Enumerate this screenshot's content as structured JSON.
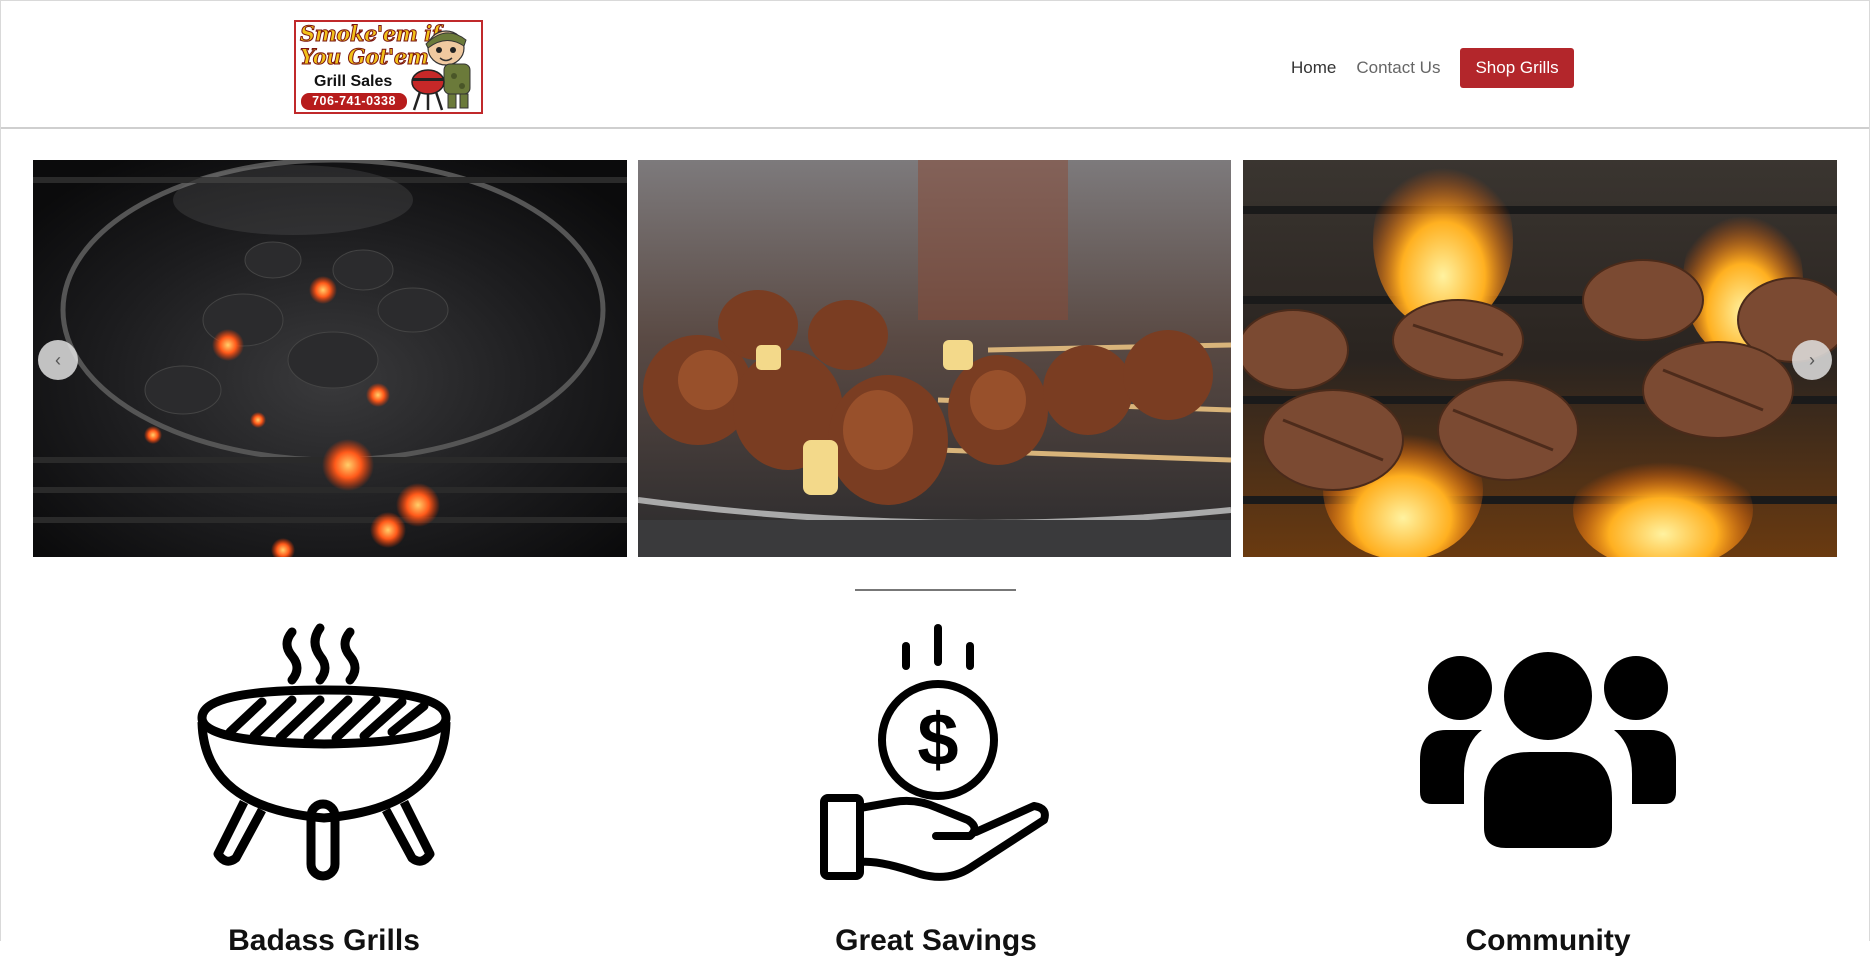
{
  "header": {
    "logo": {
      "line1": "Smoke'em if",
      "line2": "You Got'em",
      "subtitle": "Grill Sales",
      "phone": "706-741-0338"
    },
    "nav": {
      "home": "Home",
      "contact": "Contact Us",
      "shop": "Shop Grills"
    }
  },
  "carousel": {
    "prev_glyph": "‹",
    "next_glyph": "›",
    "slides": [
      "charcoal-embers-photo",
      "kebab-skewers-photo",
      "burgers-on-flame-photo"
    ]
  },
  "features": [
    {
      "icon": "grill-icon",
      "title": "Badass Grills"
    },
    {
      "icon": "savings-icon",
      "title": "Great Savings"
    },
    {
      "icon": "community-icon",
      "title": "Community"
    }
  ],
  "colors": {
    "brand_red": "#b3262b",
    "logo_yellow": "#f2c21a"
  }
}
